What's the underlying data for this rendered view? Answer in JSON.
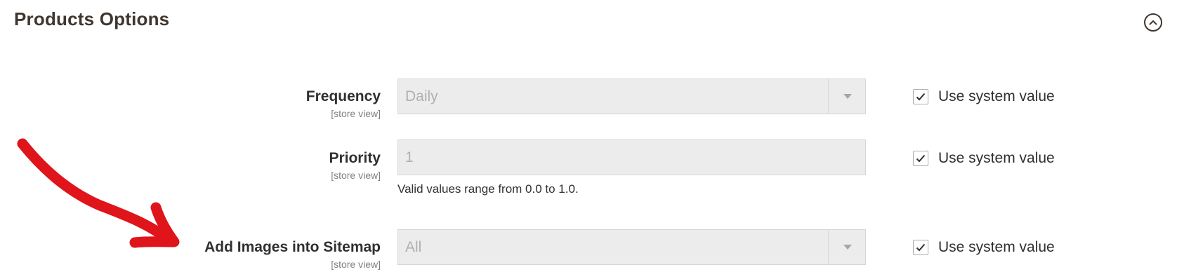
{
  "section": {
    "title": "Products Options",
    "collapse_icon": "chevron-up-circle-icon"
  },
  "fields": [
    {
      "label": "Frequency",
      "scope": "[store view]",
      "type": "select",
      "value": "Daily",
      "note": "",
      "use_system_value": {
        "checked": true,
        "label": "Use system value"
      }
    },
    {
      "label": "Priority",
      "scope": "[store view]",
      "type": "text",
      "value": "1",
      "note": "Valid values range from 0.0 to 1.0.",
      "use_system_value": {
        "checked": true,
        "label": "Use system value"
      }
    },
    {
      "label": "Add Images into Sitemap",
      "scope": "[store view]",
      "type": "select",
      "value": "All",
      "note": "",
      "use_system_value": {
        "checked": true,
        "label": "Use system value"
      }
    }
  ],
  "annotation": {
    "icon": "red-arrow-annotation",
    "color": "#e0141b"
  },
  "colors": {
    "title": "#41362f",
    "disabled_field_bg": "#ececec",
    "disabled_field_text": "#b0b0b0"
  }
}
